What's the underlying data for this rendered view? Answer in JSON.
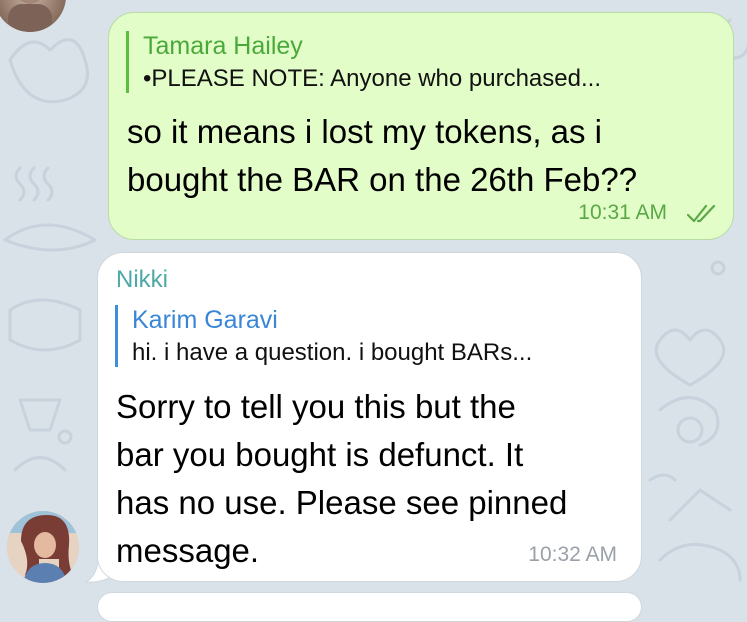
{
  "outgoing_message": {
    "reply_author": "Tamara Hailey",
    "reply_snippet": "•PLEASE NOTE: Anyone who purchased...",
    "text_lines": [
      "so it means i lost my tokens, as i",
      "bought the BAR on the 26th Feb??"
    ],
    "time": "10:31 AM",
    "status_icon": "double-check-icon"
  },
  "incoming_message": {
    "sender": "Nikki",
    "reply_author": "Karim Garavi",
    "reply_snippet": "hi. i have a question. i bought BARs...",
    "text_lines": [
      "Sorry to tell you this but the",
      "bar you bought is defunct. It",
      "has no use. Please see pinned",
      "message."
    ],
    "time": "10:32 AM"
  },
  "colors": {
    "outgoing_bubble": "#e2fdc7",
    "incoming_bubble": "#ffffff",
    "outgoing_accent": "#4aa93a",
    "reply_accent_blue": "#3a86d6",
    "sender_name": "#4fa9a5",
    "wallpaper": "#d9e1e9"
  }
}
